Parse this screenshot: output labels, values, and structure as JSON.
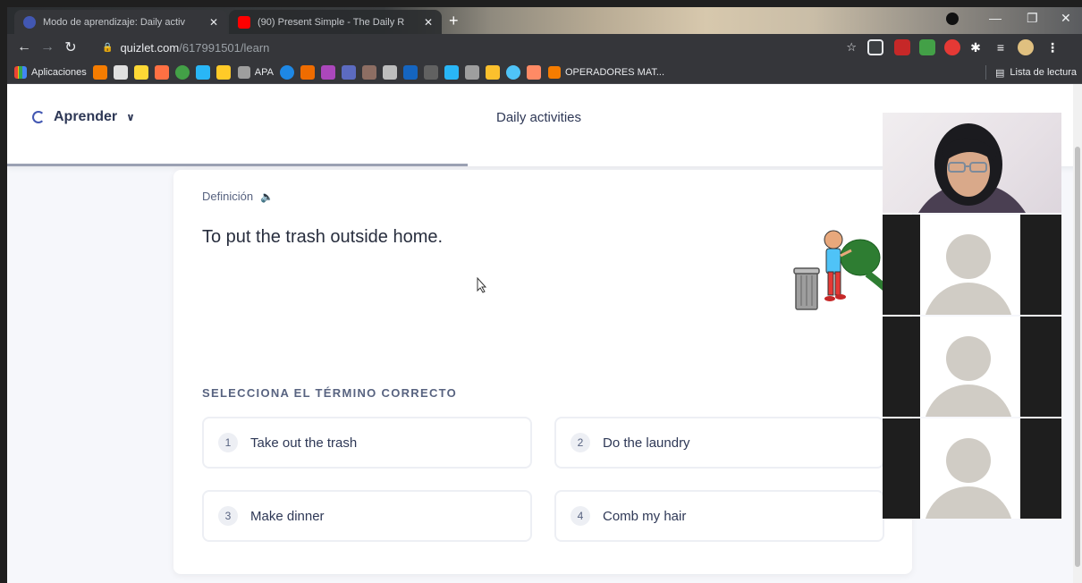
{
  "browser": {
    "tabs": [
      {
        "title": "Modo de aprendizaje: Daily activ",
        "active": true,
        "icon_color": "#4257b2"
      },
      {
        "title": "(90) Present Simple - The Daily R",
        "active": false,
        "icon_color": "#ff0000"
      }
    ],
    "url_host": "quizlet.com",
    "url_path": "/617991501/learn",
    "bookmarks": {
      "apps_label": "Aplicaciones",
      "apa_label": "APA",
      "operadores_label": "OPERADORES MAT...",
      "reading_list_label": "Lista de lectura"
    }
  },
  "quizlet": {
    "mode_label": "Aprender",
    "set_title": "Daily activities",
    "definition_label": "Definición",
    "definition_text": "To put the trash outside home.",
    "prompt": "SELECCIONA EL TÉRMINO CORRECTO",
    "options": [
      {
        "num": "1",
        "text": "Take out the trash"
      },
      {
        "num": "2",
        "text": "Do the laundry"
      },
      {
        "num": "3",
        "text": "Make dinner"
      },
      {
        "num": "4",
        "text": "Comb my hair"
      }
    ]
  },
  "colors": {
    "quizlet_primary": "#4257b2",
    "text_dark": "#2e3856",
    "text_muted": "#586380",
    "option_border": "#edeff4"
  }
}
